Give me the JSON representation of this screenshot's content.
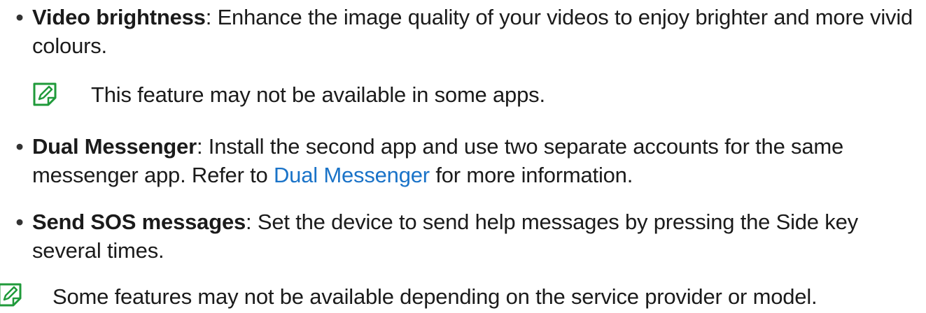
{
  "items": [
    {
      "term": "Video brightness",
      "separator": ":",
      "text": " Enhance the image quality of your videos to enjoy brighter and more vivid colours."
    },
    {
      "term": "Dual Messenger",
      "separator": ":",
      "text_before": " Install the second app and use two separate accounts for the same messenger app. Refer to ",
      "link": "Dual Messenger",
      "text_after": " for more information."
    },
    {
      "term": "Send SOS messages",
      "separator": ":",
      "text": " Set the device to send help messages by pressing the Side key several times."
    }
  ],
  "bullet_symbol": "•",
  "notes": {
    "video_note": "This feature may not be available in some apps.",
    "page_note": "Some features may not be available depending on the service provider or model."
  },
  "icons": {
    "note_icon": "note-pencil-icon",
    "note_icon_color": "#1f9a3a"
  }
}
